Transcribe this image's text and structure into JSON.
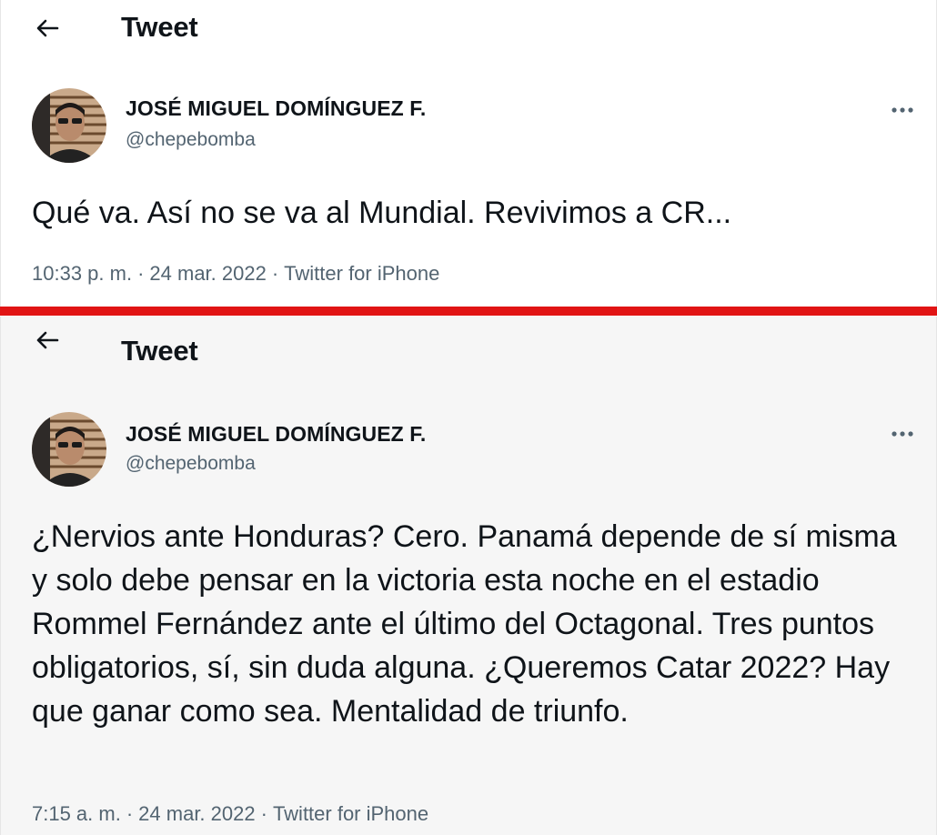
{
  "tweets": [
    {
      "header_title": "Tweet",
      "author_name": "JOSÉ MIGUEL DOMÍNGUEZ F.",
      "author_handle": "@chepebomba",
      "text": "Qué va. Así no se va al Mundial. Revivimos a CR...",
      "time": "10:33 p. m.",
      "date": "24 mar. 2022",
      "source": "Twitter for iPhone"
    },
    {
      "header_title": "Tweet",
      "author_name": "JOSÉ MIGUEL DOMÍNGUEZ F.",
      "author_handle": "@chepebomba",
      "text": "¿Nervios ante Honduras? Cero. Panamá depende de sí misma y solo debe pensar en la victoria esta noche en el estadio Rommel Fernández ante el último del Octagonal. Tres puntos obligatorios, sí, sin duda alguna. ¿Queremos Catar 2022? Hay que ganar como sea. Mentalidad de triunfo.",
      "time": "7:15 a. m.",
      "date": "24 mar. 2022",
      "source": "Twitter for iPhone"
    }
  ],
  "meta_separator": "·",
  "icons": {
    "back": "arrow-left-icon",
    "more": "more-horizontal-icon",
    "avatar": "profile-photo"
  },
  "colors": {
    "divider": "#e11414",
    "secondary_text": "#536471",
    "bottom_panel_bg": "#f6f6f6"
  }
}
